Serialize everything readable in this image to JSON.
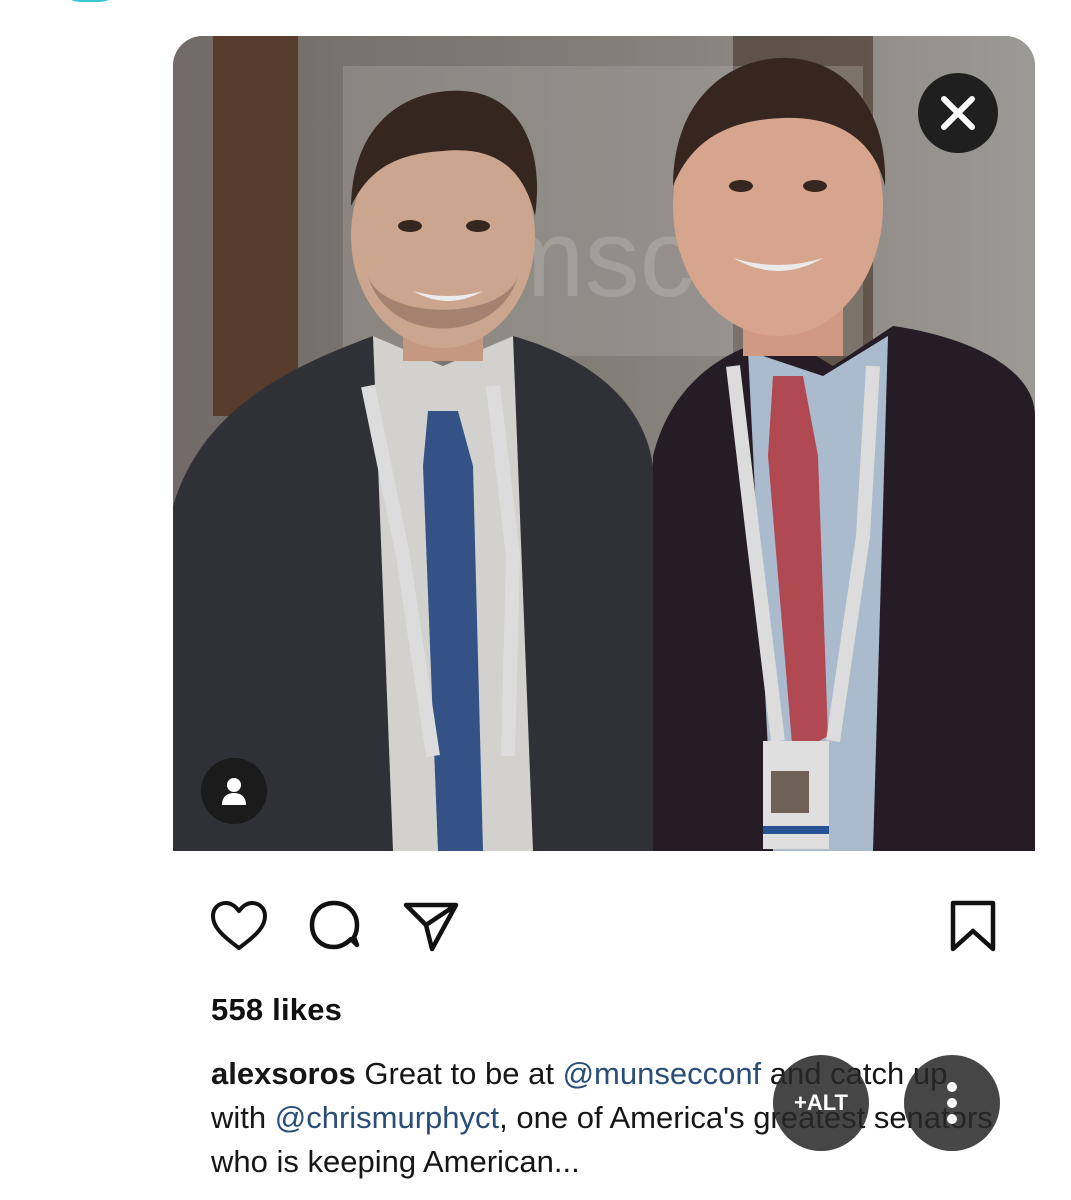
{
  "post": {
    "likes": "558 likes",
    "caption": {
      "username": "alexsoros",
      "text_1": " Great to be at ",
      "mention_1": "@munsecconf",
      "text_2": " and catch up with ",
      "mention_2": "@chrismurphyct",
      "text_3": ", one of America's greatest senators who is keeping American..."
    }
  },
  "overlay": {
    "alt_label": "+ALT"
  },
  "photo_text": {
    "lanyard_mark": "msc"
  },
  "icons": {
    "close": "close-icon",
    "tag": "person-tag-icon",
    "like": "heart-icon",
    "comment": "comment-icon",
    "share": "send-icon",
    "save": "bookmark-icon",
    "more": "more-vertical-icon"
  },
  "colors": {
    "accent": "#3cc6cf",
    "mention": "#2a4e7a",
    "overlay_button": "#1f1f1f"
  }
}
